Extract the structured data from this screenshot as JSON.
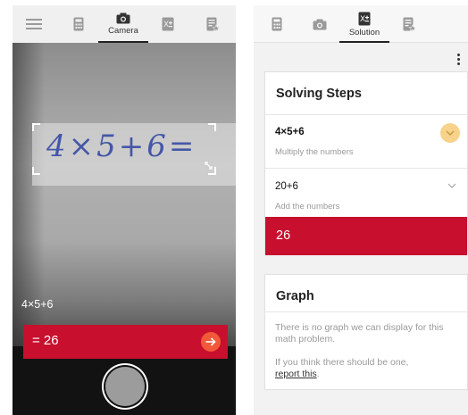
{
  "camera_screen": {
    "tabs": [
      {
        "icon": "hamburger-menu-icon",
        "label": ""
      },
      {
        "icon": "calculator-icon",
        "label": ""
      },
      {
        "icon": "camera-icon",
        "label": "Camera",
        "active": true
      },
      {
        "icon": "solution-icon",
        "label": ""
      },
      {
        "icon": "notes-icon",
        "label": ""
      }
    ],
    "handwritten_input": "4×5+6=",
    "detected_expression": "4×5+6",
    "result": "= 26",
    "colors": {
      "result_bar": "#c8102e",
      "arrow_button": "#f1593a",
      "tab_bar": "#f0f0f0"
    }
  },
  "solution_screen": {
    "tabs": [
      {
        "icon": "calculator-icon",
        "label": ""
      },
      {
        "icon": "camera-icon",
        "label": ""
      },
      {
        "icon": "solution-icon",
        "label": "Solution",
        "active": true
      },
      {
        "icon": "notes-icon",
        "label": ""
      }
    ],
    "steps_card": {
      "title": "Solving Steps",
      "steps": [
        {
          "expression": "4×5+6",
          "description": "Multiply the numbers",
          "expanded": true
        },
        {
          "expression": "20+6",
          "description": "Add the numbers",
          "expanded": false
        }
      ],
      "answer": "26"
    },
    "graph_card": {
      "title": "Graph",
      "message": "There is no graph we can display for this math problem.",
      "hint_prefix": "If you think there should be one,",
      "report_link": "report this",
      "hint_suffix": "."
    },
    "colors": {
      "answer_bar": "#c8102e",
      "chevron_badge": "#f6d28a",
      "background": "#f2f2f2"
    }
  }
}
